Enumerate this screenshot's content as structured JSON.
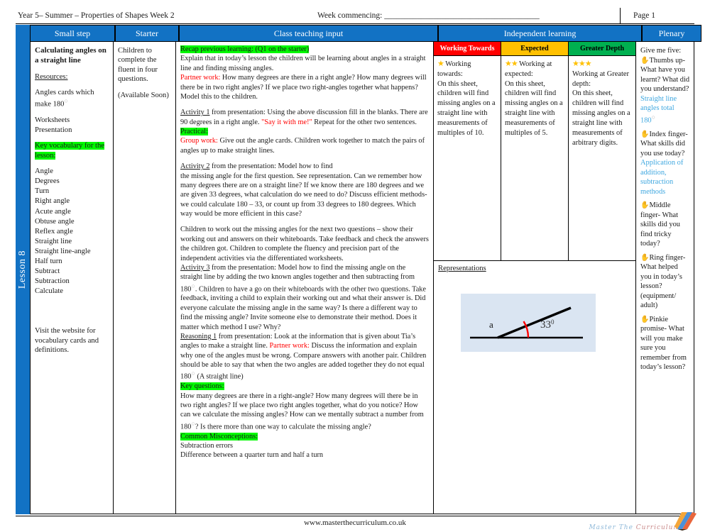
{
  "meta": {
    "title": "Year 5– Summer – Properties of Shapes Week 2",
    "week_commencing": "Week commencing: ______________________________________",
    "page": "Page 1"
  },
  "spine": {
    "lesson_label": "Lesson 8"
  },
  "headers": {
    "small_step": "Small step",
    "starter": "Starter",
    "class_teaching": "Class teaching input",
    "independent": "Independent learning",
    "plenary": "Plenary"
  },
  "small_step": {
    "title": "Calculating angles on a straight line",
    "resources_label": "Resources:",
    "resource_1": "Angles cards which make 180",
    "resource_2": "Worksheets",
    "resource_3": "Presentation",
    "vocab_heading": "Key vocabulary for the lesson:",
    "vocab": [
      "Angle",
      "Degrees",
      "Turn",
      "Right angle",
      "Acute angle",
      "Obtuse angle",
      "Reflex angle",
      "Straight line",
      "Straight line-angle",
      "Half turn",
      "Subtract",
      "Subtraction",
      "Calculate"
    ],
    "website_note": "Visit the website for vocabulary cards and definitions."
  },
  "starter": {
    "line_1": "Children to complete the fluent in four questions.",
    "line_2": "(Available Soon)"
  },
  "class_teaching": {
    "recap_heading": "Recap previous learning: (Q1 on the starter)",
    "recap_body": "Explain that in today’s lesson the children will be learning about angles in a straight line and finding missing angles.",
    "partner_work_label_1": "Partner work:",
    "partner_work_body_1": " How many degrees are there in a right angle? How many degrees will there be in two right angles? If we place two right-angles together what happens? Model this to the children.",
    "activity_1_label": "Activity 1",
    "activity_1_body_a": " from presentation: Using the above discussion fill in the blanks. There are 90 degrees in a right angle. ",
    "activity_1_quote": "\"Say it with me!\"",
    "activity_1_body_b": " Repeat for the other two sentences.",
    "practical_heading": "Practical:",
    "group_work_label": "Group work:",
    "group_work_body": " Give out the angle cards. Children work together to match the pairs of angles up to make straight lines.",
    "activity_2_label": "Activity 2",
    "activity_2_body_line1": " from the presentation: Model how to find",
    "activity_2_body": "the missing angle for the first question. See representation. Can we remember how many degrees there are on a straight line? If we know there are 180 degrees and we are given 33 degrees, what calculation do we need to do? Discuss efficient methods- we could calculate 180 – 33, or count up from 33 degrees to 180 degrees. Which way would be more efficient in this case?",
    "whiteboard_para": "Children to work out the missing angles for the next two questions – show their working out and answers on their whiteboards. Take feedback and check the answers the children got. Children to complete the fluency and precision part of the independent activities via the differentiated worksheets.",
    "activity_3_label": "Activity 3",
    "activity_3_body_a": " from the presentation: Model how to find the missing angle on the straight line by adding the two known angles together and then subtracting from 180",
    "activity_3_body_b": ". Children to have a go on their whiteboards with the other two questions. Take feedback, inviting a child to explain their working out and what their answer is. Did everyone calculate the missing angle in the same way? Is there a different way to find the missing angle? Invite someone else to demonstrate their method. Does it matter which method I use? Why?",
    "reasoning_label": "Reasoning 1",
    "reasoning_body_a": " from presentation: Look at the information that is given about Tia’s angles to make a straight line. ",
    "partner_work_label_2": "Partner work:",
    "reasoning_body_b": " Discuss the information and explain why one of the angles must be wrong. Compare answers with another pair. Children should be able to say that when the two angles are added together they do not equal 180",
    "reasoning_body_c": " (A straight line)",
    "key_questions_heading": "Key questions:",
    "key_questions_a": "How many degrees are there in a right-angle? How many degrees will there be in two right angles? If we place two right angles together, what do you notice? How can we calculate the missing angles? How can we mentally subtract a number from 180",
    "key_questions_b": "? Is there more than one way to calculate the missing angle?",
    "misconceptions_heading": "Common Misconceptions:",
    "misconception_1": "Subtraction errors",
    "misconception_2": "Difference between a quarter turn and half a turn"
  },
  "independent": {
    "columns": [
      {
        "header": "Working Towards",
        "header_color": "#FF0000",
        "stars": "★",
        "title": " Working towards:",
        "body": "On this sheet, children will find missing angles on a straight line with measurements of multiples of 10."
      },
      {
        "header": "Expected",
        "header_color": "#FFC000",
        "stars": "★★",
        "title": " Working at expected:",
        "body": " On this sheet, children will find missing angles on a straight line with measurements of multiples of 5."
      },
      {
        "header": "Greater Depth",
        "header_color": "#00B050",
        "stars": "★★★",
        "title": "Working at Greater depth:",
        "body": "On this sheet, children will find missing angles on a straight line with measurements of arbitrary digits."
      }
    ],
    "representations_label": "Representations",
    "diagram": {
      "angle_label_known": "33",
      "angle_label_known_sup": "0",
      "angle_label_unknown": "a",
      "arc_color": "#FF0000",
      "background_color": "#DAE5F2"
    }
  },
  "plenary": {
    "intro": "Give me five:",
    "items": [
      {
        "icon": "hand-icon",
        "question": "Thumbs up- What have you learnt? What did you understand?",
        "answer": "Straight line angles total 180"
      },
      {
        "icon": "hand-icon",
        "question": "Index finger- What skills did you use today?",
        "answer": "Application of addition, subtraction methods"
      },
      {
        "icon": "hand-icon",
        "question": "Middle finger- What skills did you find tricky today?",
        "answer": ""
      },
      {
        "icon": "hand-icon",
        "question": "Ring finger- What helped you in today’s lesson? (equipment/ adult)",
        "answer": ""
      },
      {
        "icon": "hand-icon",
        "question": "Pinkie promise- What will you make sure you remember from today’s lesson?",
        "answer": ""
      }
    ]
  },
  "footer": {
    "url": "www.masterthecurriculum.co.uk",
    "brand_word_1": "Master",
    "brand_word_2": "The",
    "brand_word_3": "Curriculum"
  }
}
